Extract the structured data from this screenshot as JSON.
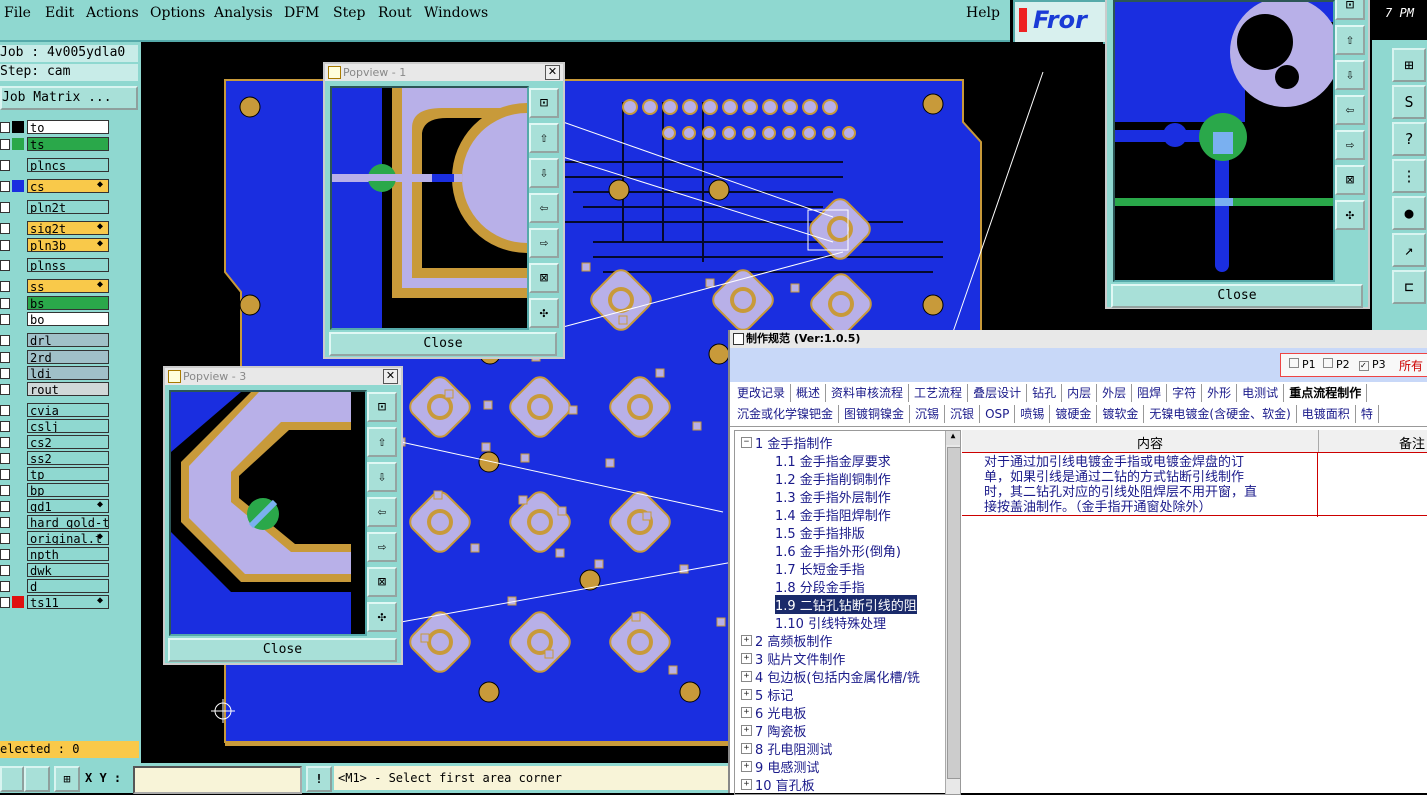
{
  "menubar": {
    "items": [
      "File",
      "Edit",
      "Actions",
      "Options",
      "Analysis",
      "DFM",
      "Step",
      "Rout",
      "Windows"
    ],
    "help": "Help",
    "brand": "Fror",
    "clock_partial": "7 PM"
  },
  "job": {
    "job_label": "Job : 4v005ydla0",
    "step_label": "Step: cam",
    "matrix_button": "Job Matrix ..."
  },
  "layers": [
    {
      "name": "to",
      "color": "#000000",
      "bg": "#ffffff"
    },
    {
      "name": "ts",
      "color": "#2aa84a",
      "bg": "#2aa84a"
    },
    {
      "name": "plncs",
      "color": "",
      "bg": "#8fd8d0"
    },
    {
      "name": "cs",
      "color": "#1a2ee0",
      "bg": "#f9c94a",
      "lock": "true"
    },
    {
      "name": "pln2t",
      "color": "",
      "bg": "#8fd8d0"
    },
    {
      "name": "sig2t",
      "color": "",
      "bg": "#f9c94a",
      "lock": "true"
    },
    {
      "name": "pln3b",
      "color": "",
      "bg": "#f9c94a",
      "lock": "true"
    },
    {
      "name": "plnss",
      "color": "",
      "bg": "#8fd8d0"
    },
    {
      "name": "ss",
      "color": "",
      "bg": "#f9c94a",
      "lock": "true"
    },
    {
      "name": "bs",
      "color": "",
      "bg": "#2aa84a"
    },
    {
      "name": "bo",
      "color": "",
      "bg": "#ffffff"
    },
    {
      "name": "drl",
      "color": "",
      "bg": "#a0c0c8"
    },
    {
      "name": "2rd",
      "color": "",
      "bg": "#a0c0c8"
    },
    {
      "name": "ldi",
      "color": "",
      "bg": "#a0c0c8"
    },
    {
      "name": "rout",
      "color": "",
      "bg": "#d0d8d8"
    },
    {
      "name": "cvia",
      "color": "",
      "bg": "#8fd8d0"
    },
    {
      "name": "cslj",
      "color": "",
      "bg": "#8fd8d0"
    },
    {
      "name": "cs2",
      "color": "",
      "bg": "#8fd8d0"
    },
    {
      "name": "ss2",
      "color": "",
      "bg": "#8fd8d0"
    },
    {
      "name": "tp",
      "color": "",
      "bg": "#8fd8d0"
    },
    {
      "name": "bp",
      "color": "",
      "bg": "#8fd8d0"
    },
    {
      "name": "gd1",
      "color": "",
      "bg": "#8fd8d0",
      "lock": "true"
    },
    {
      "name": "hard_gold-t",
      "color": "",
      "bg": "#8fd8d0"
    },
    {
      "name": "original.t",
      "color": "",
      "bg": "#8fd8d0",
      "lock": "true"
    },
    {
      "name": "npth",
      "color": "",
      "bg": "#8fd8d0"
    },
    {
      "name": "dwk",
      "color": "",
      "bg": "#8fd8d0"
    },
    {
      "name": "d",
      "color": "",
      "bg": "#8fd8d0"
    },
    {
      "name": "ts11",
      "color": "#e01010",
      "bg": "#8fd8d0",
      "lock": "true"
    }
  ],
  "status": {
    "selected": "elected : 0",
    "xy_label": "X Y :",
    "prompt": "<M1> - Select first area corner"
  },
  "popviews": {
    "p1": {
      "title": "Popview - 1",
      "close": "Close"
    },
    "p3": {
      "title": "Popview - 3",
      "close": "Close"
    },
    "pr": {
      "close": "Close"
    }
  },
  "spec": {
    "title": "制作规范 (Ver:1.0.5)",
    "filters": [
      "P1",
      "P2",
      "P3"
    ],
    "filter_checked": [
      false,
      false,
      true
    ],
    "all_label": "所有",
    "tabs1": [
      "更改记录",
      "概述",
      "资料审核流程",
      "工艺流程",
      "叠层设计",
      "钻孔",
      "内层",
      "外层",
      "阻焊",
      "字符",
      "外形",
      "电测试",
      "重点流程制作"
    ],
    "tabs2": [
      "沉金或化学镍钯金",
      "图镀铜镍金",
      "沉锡",
      "沉银",
      "OSP",
      "喷锡",
      "镀硬金",
      "镀软金",
      "无镍电镀金(含硬金、软金)",
      "电镀面积",
      "特"
    ],
    "tree": [
      {
        "label": "1 金手指制作",
        "level": 0,
        "expanded": true
      },
      {
        "label": "1.1 金手指金厚要求",
        "level": 1
      },
      {
        "label": "1.2 金手指削铜制作",
        "level": 1
      },
      {
        "label": "1.3 金手指外层制作",
        "level": 1
      },
      {
        "label": "1.4 金手指阻焊制作",
        "level": 1
      },
      {
        "label": "1.5 金手指排版",
        "level": 1
      },
      {
        "label": "1.6 金手指外形(倒角)",
        "level": 1
      },
      {
        "label": "1.7 长短金手指",
        "level": 1
      },
      {
        "label": "1.8 分段金手指",
        "level": 1
      },
      {
        "label": "1.9 二钻孔钻断引线的阻",
        "level": 1,
        "selected": true
      },
      {
        "label": "1.10 引线特殊处理",
        "level": 1
      },
      {
        "label": "2 高频板制作",
        "level": 0
      },
      {
        "label": "3 贴片文件制作",
        "level": 0
      },
      {
        "label": "4 包边板(包括内金属化槽/铣",
        "level": 0
      },
      {
        "label": "5 标记",
        "level": 0
      },
      {
        "label": "6 光电板",
        "level": 0
      },
      {
        "label": "7 陶瓷板",
        "level": 0
      },
      {
        "label": "8 孔电阻测试",
        "level": 0
      },
      {
        "label": "9 电感测试",
        "level": 0
      },
      {
        "label": "10 盲孔板",
        "level": 0
      }
    ],
    "table_headers": [
      "内容",
      "备注"
    ],
    "content": [
      "对于通过加引线电镀金手指或电镀金焊盘的订",
      "单，如果引线是通过二钻的方式钻断引线制作",
      "时，其二钻孔对应的引线处阻焊层不用开窗，直",
      "接按盖油制作。（金手指开通窗处除外）"
    ]
  },
  "colors": {
    "copper": "#1a2ee0",
    "pad_gold": "#c89a3a",
    "pad_lilac": "#b8b0e8",
    "panel": "#8fd8d0",
    "highlight": "#f9c94a"
  }
}
